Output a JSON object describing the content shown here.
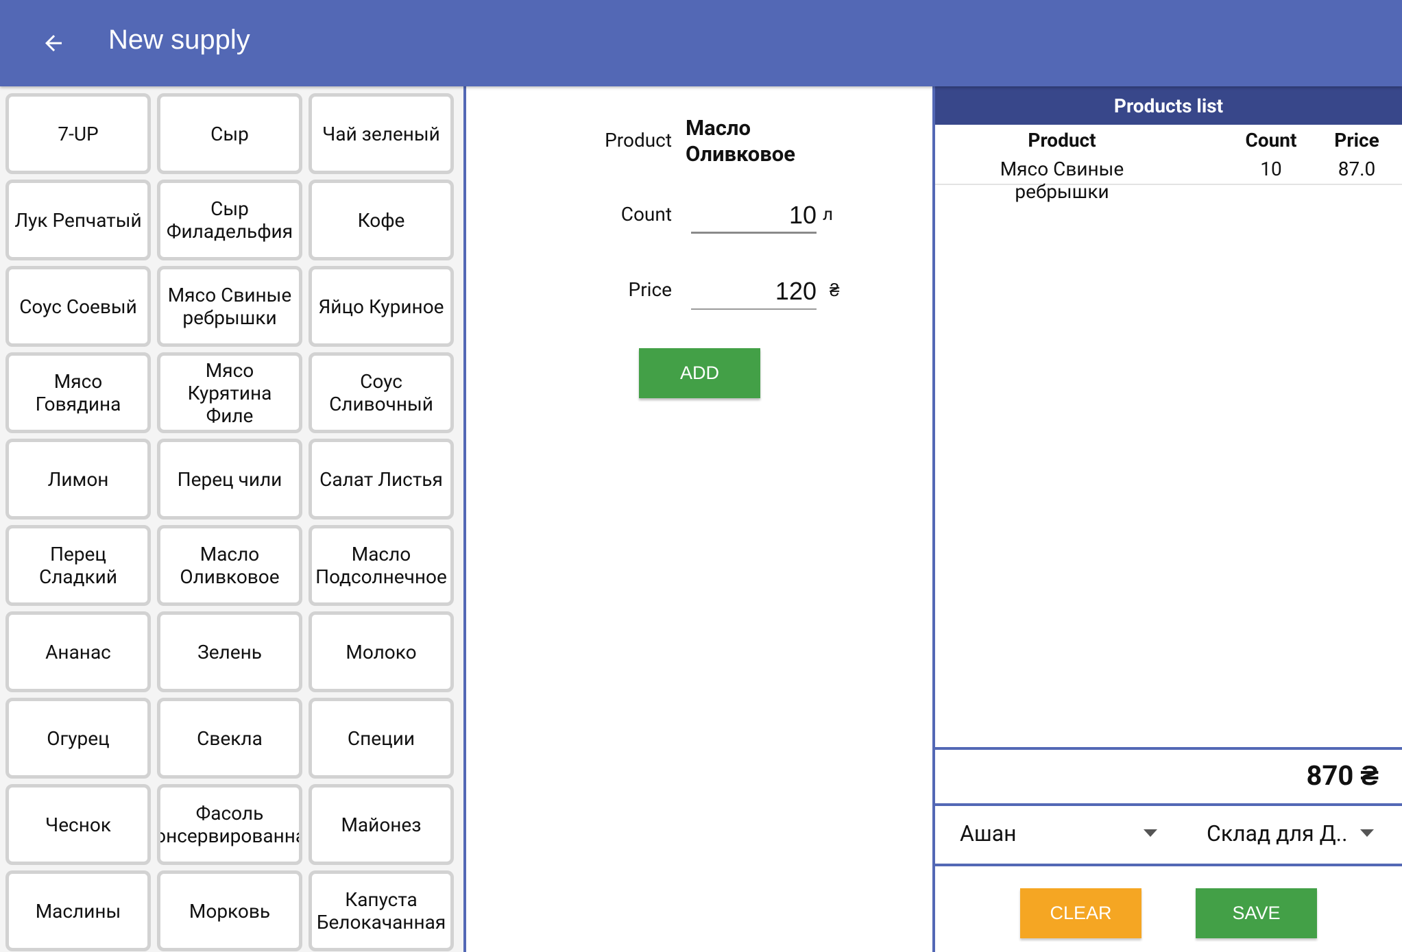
{
  "header": {
    "title": "New supply",
    "back_icon": "arrow-left-icon"
  },
  "products": [
    "7-UP",
    "Сыр",
    "Чай зеленый",
    "Лук Репчатый",
    "Сыр Филадельфия",
    "Кофе",
    "Соус Соевый",
    "Мясо Свиные ребрышки",
    "Яйцо Куриное",
    "Мясо Говядина",
    "Мясо Курятина Филе",
    "Соус Сливочный",
    "Лимон",
    "Перец чили",
    "Салат Листья",
    "Перец Сладкий",
    "Масло Оливковое",
    "Масло Подсолнечное",
    "Ананас",
    "Зелень",
    "Молоко",
    "Огурец",
    "Свекла",
    "Специи",
    "Чеснок",
    "Фасоль Консервированная",
    "Майонез",
    "Маслины",
    "Морковь",
    "Капуста Белокачанная"
  ],
  "form": {
    "product_label": "Product",
    "product_value_line1": "Масло",
    "product_value_line2": "Оливковое",
    "count_label": "Count",
    "count_value": "10",
    "count_unit": "л",
    "price_label": "Price",
    "price_value": "120",
    "price_unit": "₴",
    "add_label": "ADD"
  },
  "list": {
    "title": "Products list",
    "headers": {
      "product": "Product",
      "count": "Count",
      "price": "Price"
    },
    "rows": [
      {
        "product": "Мясо Свиные ребрышки",
        "count": "10",
        "price": "87.0"
      }
    ],
    "total": "870 ₴",
    "supplier": "Ашан",
    "warehouse": "Склад для Д..",
    "clear_label": "CLEAR",
    "save_label": "SAVE"
  },
  "colors": {
    "appbar": "#5368b5",
    "list_title": "#38478a",
    "add": "#43a047",
    "clear": "#f5a623",
    "save": "#43a047"
  }
}
